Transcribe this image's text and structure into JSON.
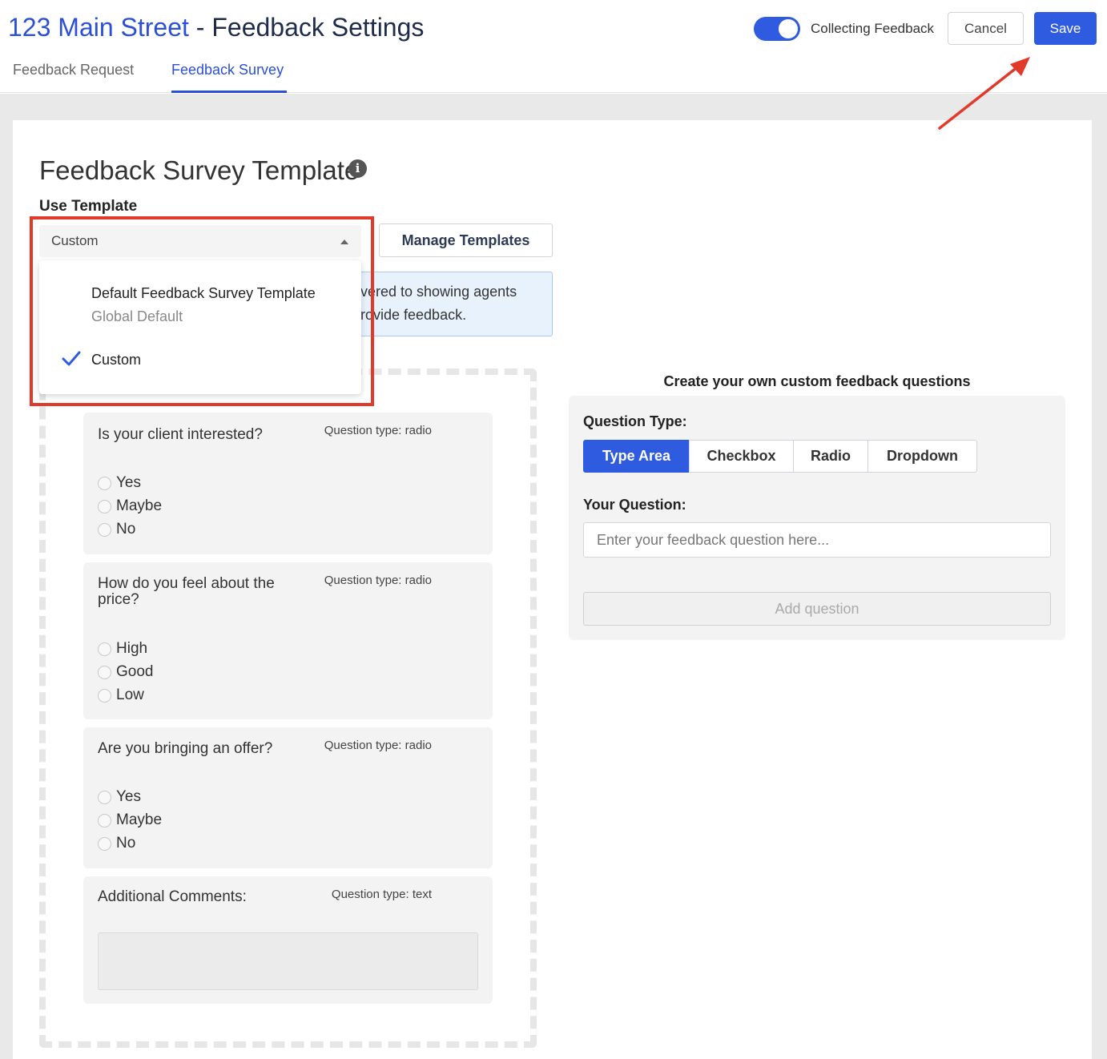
{
  "header": {
    "address": "123 Main Street",
    "separator": " - ",
    "page_name": "Feedback Settings",
    "toggle_label": "Collecting Feedback",
    "toggle_on": true,
    "cancel_label": "Cancel",
    "save_label": "Save"
  },
  "tabs": [
    {
      "label": "Feedback Request",
      "active": false
    },
    {
      "label": "Feedback Survey",
      "active": true
    }
  ],
  "template_section": {
    "title": "Feedback Survey Template",
    "info_icon": "info-icon",
    "use_template_label": "Use Template",
    "selected_template": "Custom",
    "manage_templates_label": "Manage Templates",
    "info_box_line1": "vered to showing agents",
    "info_box_line2": "rovide feedback.",
    "dropdown_options": [
      {
        "title": "Default Feedback Survey Template",
        "subtitle": "Global Default",
        "selected": false
      },
      {
        "title": "Custom",
        "subtitle": "",
        "selected": true
      }
    ]
  },
  "questions": [
    {
      "text": "Is your client interested?",
      "type": "Question type: radio",
      "options": [
        "Yes",
        "Maybe",
        "No"
      ]
    },
    {
      "text": "How do you feel about the price?",
      "type": "Question type: radio",
      "options": [
        "High",
        "Good",
        "Low"
      ]
    },
    {
      "text": "Are you bringing an offer?",
      "type": "Question type: radio",
      "options": [
        "Yes",
        "Maybe",
        "No"
      ]
    },
    {
      "text": "Additional Comments:",
      "type": "Question type: text",
      "options": []
    }
  ],
  "custom_builder": {
    "heading": "Create your own custom feedback questions",
    "question_type_label": "Question Type:",
    "types": [
      "Type Area",
      "Checkbox",
      "Radio",
      "Dropdown"
    ],
    "active_type": "Type Area",
    "your_question_label": "Your Question:",
    "question_placeholder": "Enter your feedback question here...",
    "question_value": "",
    "add_button_label": "Add question"
  },
  "annotation_colors": {
    "highlight": "#e23a2a",
    "accent": "#2f5be0"
  }
}
